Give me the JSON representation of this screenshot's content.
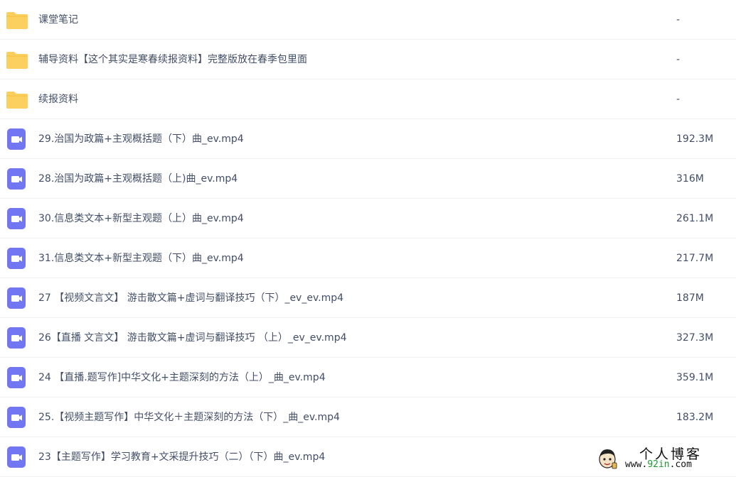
{
  "colors": {
    "folder": "#fcd05f",
    "video_icon": "#7276f0",
    "text": "#424e67",
    "row_divider": "#f1f2f4"
  },
  "files": [
    {
      "type": "folder",
      "icon": "folder-icon",
      "name": "课堂笔记",
      "size": "-"
    },
    {
      "type": "folder",
      "icon": "folder-icon",
      "name": "辅导资料【这个其实是寒春续报资料】完整版放在春季包里面",
      "size": "-"
    },
    {
      "type": "folder",
      "icon": "folder-icon",
      "name": "续报资料",
      "size": "-"
    },
    {
      "type": "video",
      "icon": "video-file-icon",
      "name": "29.治国为政篇+主观概括题（下）曲_ev.mp4",
      "size": "192.3M"
    },
    {
      "type": "video",
      "icon": "video-file-icon",
      "name": "28.治国为政篇+主观概括题（上)曲_ev.mp4",
      "size": "316M"
    },
    {
      "type": "video",
      "icon": "video-file-icon",
      "name": "30.信息类文本+新型主观题（上）曲_ev.mp4",
      "size": "261.1M"
    },
    {
      "type": "video",
      "icon": "video-file-icon",
      "name": "31.信息类文本+新型主观题（下）曲_ev.mp4",
      "size": "217.7M"
    },
    {
      "type": "video",
      "icon": "video-file-icon",
      "name": "27 【视频文言文】 游击散文篇+虚词与翻译技巧（下）_ev_ev.mp4",
      "size": "187M"
    },
    {
      "type": "video",
      "icon": "video-file-icon",
      "name": "26【直播 文言文】 游击散文篇+虚词与翻译技巧 （上）_ev_ev.mp4",
      "size": "327.3M"
    },
    {
      "type": "video",
      "icon": "video-file-icon",
      "name": "24 【直播.题写作]中华文化+主题深刻的方法（上）_曲_ev.mp4",
      "size": "359.1M"
    },
    {
      "type": "video",
      "icon": "video-file-icon",
      "name": "25.【视频主题写作】中华文化＋主题深刻的方法（下）_曲_ev.mp4",
      "size": "183.2M"
    },
    {
      "type": "video",
      "icon": "video-file-icon",
      "name": "23【主题写作】学习教育+文采提升技巧（二）（下）曲_ev.mp4",
      "size": ""
    }
  ],
  "watermark": {
    "title": "个人博客",
    "url_prefix": "www.",
    "url_highlight": "92in",
    "url_suffix": ".com"
  }
}
